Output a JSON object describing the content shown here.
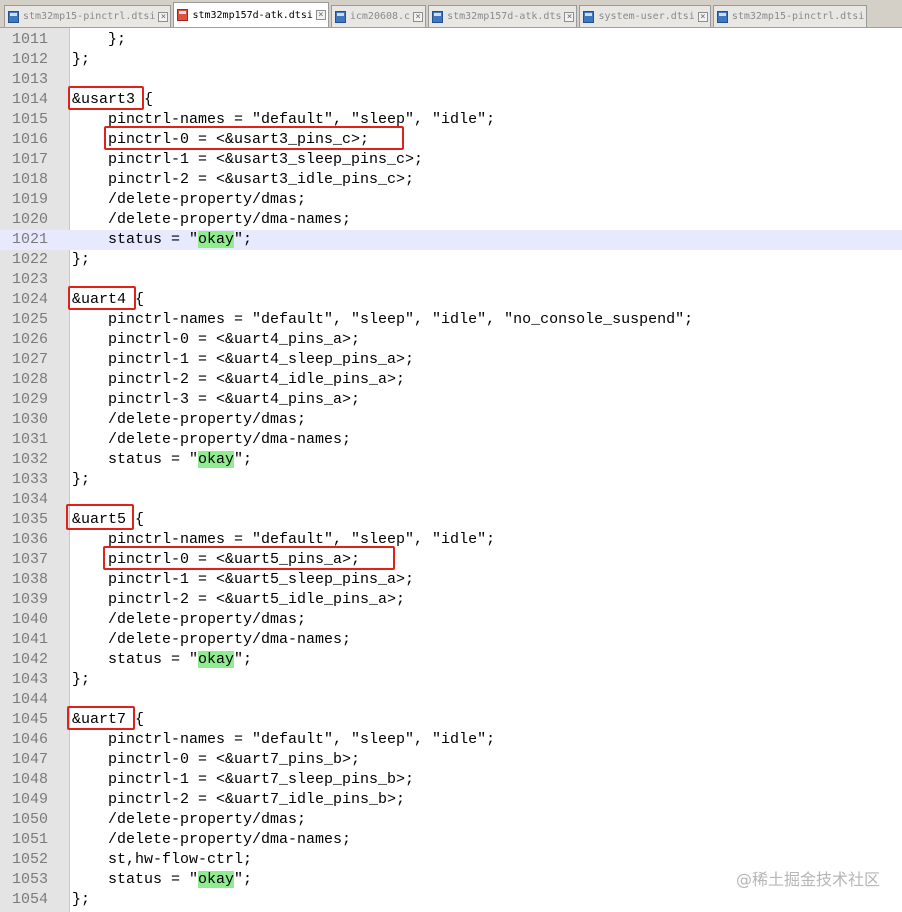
{
  "tabs": [
    {
      "label": "stm32mp15-pinctrl.dtsi",
      "active": false
    },
    {
      "label": "stm32mp157d-atk.dtsi",
      "active": true
    },
    {
      "label": "icm20608.c",
      "active": false
    },
    {
      "label": "stm32mp157d-atk.dts",
      "active": false
    },
    {
      "label": "system-user.dtsi",
      "active": false
    },
    {
      "label": "stm32mp15-pinctrl.dtsi",
      "active": false
    }
  ],
  "current_line": "1021",
  "lines": [
    {
      "n": "1011",
      "pre": "    };",
      "okay": "",
      "post": ""
    },
    {
      "n": "1012",
      "pre": "};",
      "okay": "",
      "post": ""
    },
    {
      "n": "1013",
      "pre": "",
      "okay": "",
      "post": ""
    },
    {
      "n": "1014",
      "pre": "&usart3 {",
      "okay": "",
      "post": ""
    },
    {
      "n": "1015",
      "pre": "    pinctrl-names = \"default\", \"sleep\", \"idle\";",
      "okay": "",
      "post": ""
    },
    {
      "n": "1016",
      "pre": "    pinctrl-0 = <&usart3_pins_c>;",
      "okay": "",
      "post": ""
    },
    {
      "n": "1017",
      "pre": "    pinctrl-1 = <&usart3_sleep_pins_c>;",
      "okay": "",
      "post": ""
    },
    {
      "n": "1018",
      "pre": "    pinctrl-2 = <&usart3_idle_pins_c>;",
      "okay": "",
      "post": ""
    },
    {
      "n": "1019",
      "pre": "    /delete-property/dmas;",
      "okay": "",
      "post": ""
    },
    {
      "n": "1020",
      "pre": "    /delete-property/dma-names;",
      "okay": "",
      "post": ""
    },
    {
      "n": "1021",
      "pre": "    status = \"",
      "okay": "okay",
      "post": "\";"
    },
    {
      "n": "1022",
      "pre": "};",
      "okay": "",
      "post": ""
    },
    {
      "n": "1023",
      "pre": "",
      "okay": "",
      "post": ""
    },
    {
      "n": "1024",
      "pre": "&uart4 {",
      "okay": "",
      "post": ""
    },
    {
      "n": "1025",
      "pre": "    pinctrl-names = \"default\", \"sleep\", \"idle\", \"no_console_suspend\";",
      "okay": "",
      "post": ""
    },
    {
      "n": "1026",
      "pre": "    pinctrl-0 = <&uart4_pins_a>;",
      "okay": "",
      "post": ""
    },
    {
      "n": "1027",
      "pre": "    pinctrl-1 = <&uart4_sleep_pins_a>;",
      "okay": "",
      "post": ""
    },
    {
      "n": "1028",
      "pre": "    pinctrl-2 = <&uart4_idle_pins_a>;",
      "okay": "",
      "post": ""
    },
    {
      "n": "1029",
      "pre": "    pinctrl-3 = <&uart4_pins_a>;",
      "okay": "",
      "post": ""
    },
    {
      "n": "1030",
      "pre": "    /delete-property/dmas;",
      "okay": "",
      "post": ""
    },
    {
      "n": "1031",
      "pre": "    /delete-property/dma-names;",
      "okay": "",
      "post": ""
    },
    {
      "n": "1032",
      "pre": "    status = \"",
      "okay": "okay",
      "post": "\";"
    },
    {
      "n": "1033",
      "pre": "};",
      "okay": "",
      "post": ""
    },
    {
      "n": "1034",
      "pre": "",
      "okay": "",
      "post": ""
    },
    {
      "n": "1035",
      "pre": "&uart5 {",
      "okay": "",
      "post": ""
    },
    {
      "n": "1036",
      "pre": "    pinctrl-names = \"default\", \"sleep\", \"idle\";",
      "okay": "",
      "post": ""
    },
    {
      "n": "1037",
      "pre": "    pinctrl-0 = <&uart5_pins_a>;",
      "okay": "",
      "post": ""
    },
    {
      "n": "1038",
      "pre": "    pinctrl-1 = <&uart5_sleep_pins_a>;",
      "okay": "",
      "post": ""
    },
    {
      "n": "1039",
      "pre": "    pinctrl-2 = <&uart5_idle_pins_a>;",
      "okay": "",
      "post": ""
    },
    {
      "n": "1040",
      "pre": "    /delete-property/dmas;",
      "okay": "",
      "post": ""
    },
    {
      "n": "1041",
      "pre": "    /delete-property/dma-names;",
      "okay": "",
      "post": ""
    },
    {
      "n": "1042",
      "pre": "    status = \"",
      "okay": "okay",
      "post": "\";"
    },
    {
      "n": "1043",
      "pre": "};",
      "okay": "",
      "post": ""
    },
    {
      "n": "1044",
      "pre": "",
      "okay": "",
      "post": ""
    },
    {
      "n": "1045",
      "pre": "&uart7 {",
      "okay": "",
      "post": ""
    },
    {
      "n": "1046",
      "pre": "    pinctrl-names = \"default\", \"sleep\", \"idle\";",
      "okay": "",
      "post": ""
    },
    {
      "n": "1047",
      "pre": "    pinctrl-0 = <&uart7_pins_b>;",
      "okay": "",
      "post": ""
    },
    {
      "n": "1048",
      "pre": "    pinctrl-1 = <&uart7_sleep_pins_b>;",
      "okay": "",
      "post": ""
    },
    {
      "n": "1049",
      "pre": "    pinctrl-2 = <&uart7_idle_pins_b>;",
      "okay": "",
      "post": ""
    },
    {
      "n": "1050",
      "pre": "    /delete-property/dmas;",
      "okay": "",
      "post": ""
    },
    {
      "n": "1051",
      "pre": "    /delete-property/dma-names;",
      "okay": "",
      "post": ""
    },
    {
      "n": "1052",
      "pre": "    st,hw-flow-ctrl;",
      "okay": "",
      "post": ""
    },
    {
      "n": "1053",
      "pre": "    status = \"",
      "okay": "okay",
      "post": "\";"
    },
    {
      "n": "1054",
      "pre": "};",
      "okay": "",
      "post": ""
    }
  ],
  "annotations": [
    "&usart3",
    "pinctrl-0 = <&usart3_pins_c>;",
    "&uart4",
    "&uart5",
    "pinctrl-0 = <&uart5_pins_a>;",
    "&uart7"
  ],
  "highlight_color": "#8fec8f",
  "annotation_color": "#e0231a",
  "watermark": "@稀土掘金技术社区"
}
